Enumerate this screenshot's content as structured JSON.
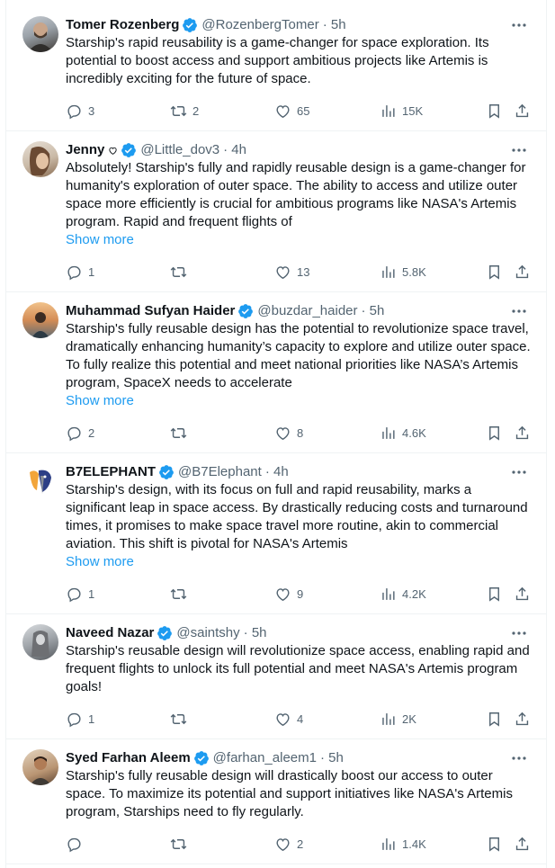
{
  "tweets": [
    {
      "name": "Tomer Rozenberg",
      "handle": "@RozenbergTomer",
      "time": "· 5h",
      "text": "Starship's rapid reusability is a game-changer for space exploration. Its potential to boost access and support ambitious projects like Artemis is incredibly exciting for the future of space.",
      "show_more": "",
      "replies": "3",
      "retweets": "2",
      "likes": "65",
      "views": "15K"
    },
    {
      "name": "Jenny",
      "handle": "@Little_dov3",
      "time": "· 4h",
      "text": "Absolutely! Starship's fully and rapidly reusable design is a game-changer for humanity's exploration of outer space. The ability to access and utilize outer space more efficiently is crucial for ambitious programs like NASA's Artemis program. Rapid and frequent flights of",
      "show_more": "Show more",
      "replies": "1",
      "retweets": "",
      "likes": "13",
      "views": "5.8K"
    },
    {
      "name": "Muhammad Sufyan Haider",
      "handle": "@buzdar_haider",
      "time": "· 5h",
      "text": "Starship's fully reusable design has the potential to revolutionize space travel, dramatically enhancing humanity’s capacity to explore and utilize outer space. To fully realize this potential and meet national priorities like NASA’s Artemis program, SpaceX needs to accelerate",
      "show_more": "Show more",
      "replies": "2",
      "retweets": "",
      "likes": "8",
      "views": "4.6K"
    },
    {
      "name": "B7ELEPHANT",
      "handle": "@B7Elephant",
      "time": "· 4h",
      "text": "Starship's design, with its focus on full and rapid reusability, marks a significant leap in space access. By drastically reducing costs and turnaround times, it promises to make space travel more routine, akin to commercial aviation. This shift is pivotal for NASA's Artemis",
      "show_more": "Show more",
      "replies": "1",
      "retweets": "",
      "likes": "9",
      "views": "4.2K"
    },
    {
      "name": "Naveed Nazar",
      "handle": "@saintshy",
      "time": "· 5h",
      "text": "Starship's reusable design will revolutionize space access, enabling rapid and frequent flights to unlock its full potential and meet NASA's Artemis program goals!",
      "show_more": "",
      "replies": "1",
      "retweets": "",
      "likes": "4",
      "views": "2K"
    },
    {
      "name": "Syed Farhan Aleem",
      "handle": "@farhan_aleem1",
      "time": "· 5h",
      "text": "Starship's fully reusable design will drastically boost our access to outer space. To maximize its potential and support initiatives like NASA's Artemis program, Starships need to fly regularly.",
      "show_more": "",
      "replies": "",
      "retweets": "",
      "likes": "2",
      "views": "1.4K"
    }
  ],
  "colors": {
    "accent": "#1d9bf0",
    "muted": "#536471",
    "text": "#0f1419",
    "verified": "#1d9bf0"
  }
}
